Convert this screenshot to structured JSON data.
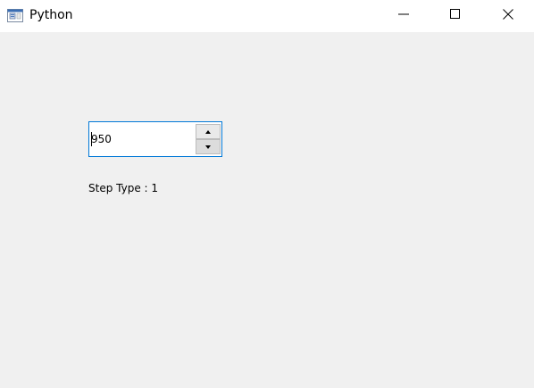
{
  "window": {
    "title": "Python",
    "icon": "python-app-icon",
    "controls": [
      "minimize-icon",
      "maximize-icon",
      "close-icon"
    ]
  },
  "spinbox": {
    "value": "950",
    "up_icon": "arrow-up-icon",
    "down_icon": "arrow-down-icon",
    "focus_color": "#0078d7"
  },
  "label": {
    "text": "Step Type : 1"
  },
  "colors": {
    "background": "#f0f0f0",
    "titlebar": "#ffffff"
  }
}
